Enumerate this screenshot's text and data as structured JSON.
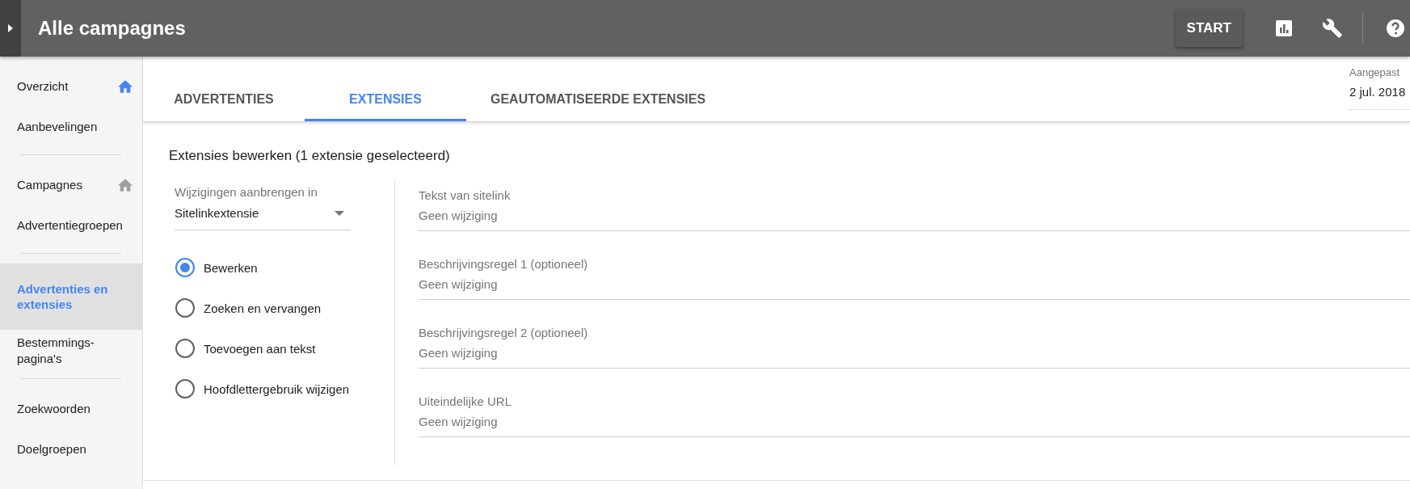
{
  "top_bar": {
    "title": "Alle campagnes",
    "start_button": "START"
  },
  "sidebar": {
    "groups": [
      {
        "items": [
          {
            "label": "Overzicht",
            "selected": false,
            "kind": "home",
            "current": true
          },
          {
            "label": "Aanbevelingen",
            "selected": false,
            "kind": "plain"
          }
        ]
      },
      {
        "items": [
          {
            "label": "Campagnes",
            "selected": false,
            "kind": "home",
            "current": false
          },
          {
            "label": "Advertentiegroepen",
            "selected": false,
            "kind": "plain"
          }
        ]
      },
      {
        "items": [
          {
            "label": "Advertenties en extensies",
            "selected": true,
            "kind": "plain"
          },
          {
            "label": "Bestemmings-pagina's",
            "selected": false,
            "kind": "plain"
          }
        ]
      },
      {
        "items": [
          {
            "label": "Zoekwoorden",
            "selected": false,
            "kind": "plain"
          },
          {
            "label": "Doelgroepen",
            "selected": false,
            "kind": "plain"
          }
        ]
      }
    ]
  },
  "tabs": [
    {
      "label": "ADVERTENTIES",
      "selected": false
    },
    {
      "label": "EXTENSIES",
      "selected": true
    },
    {
      "label": "GEAUTOMATISEERDE EXTENSIES",
      "selected": false
    }
  ],
  "date_field": {
    "label": "Aangepast",
    "value": "2 jul. 2018"
  },
  "editor": {
    "heading": "Extensies bewerken (1 extensie geselecteerd)",
    "apply_to": {
      "label": "Wijzigingen aanbrengen in",
      "value": "Sitelinkextensie"
    },
    "options": [
      {
        "label": "Bewerken",
        "selected": true
      },
      {
        "label": "Zoeken en vervangen",
        "selected": false
      },
      {
        "label": "Toevoegen aan tekst",
        "selected": false
      },
      {
        "label": "Hoofdlettergebruik wijzigen",
        "selected": false
      }
    ],
    "fields": [
      {
        "label": "Tekst van sitelink",
        "placeholder": "Geen wijziging"
      },
      {
        "label": "Beschrijvingsregel 1 (optioneel)",
        "placeholder": "Geen wijziging"
      },
      {
        "label": "Beschrijvingsregel 2 (optioneel)",
        "placeholder": "Geen wijziging"
      },
      {
        "label": "Uiteindelijke URL",
        "placeholder": "Geen wijziging"
      }
    ]
  }
}
